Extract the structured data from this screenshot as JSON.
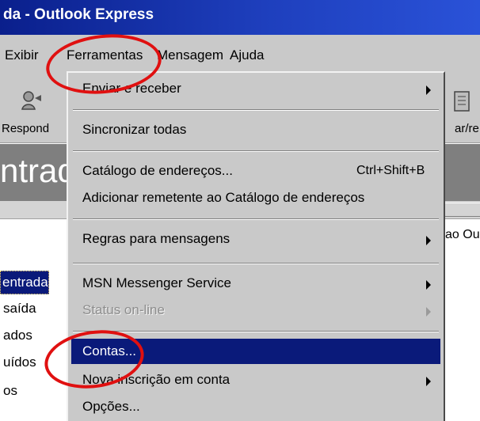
{
  "window": {
    "title": "da - Outlook Express"
  },
  "menubar": {
    "items": [
      {
        "label": "Exibir"
      },
      {
        "label": "Ferramentas"
      },
      {
        "label": "Mensagem"
      },
      {
        "label": "Ajuda"
      }
    ]
  },
  "toolbar": {
    "reply_label": "Respond",
    "forward_label": "ar/re"
  },
  "folder_header": {
    "title": "ntrad"
  },
  "side_text": "ao Ou",
  "folders": [
    {
      "label": "entrada"
    },
    {
      "label": "saída"
    },
    {
      "label": "ados"
    },
    {
      "label": "uídos"
    },
    {
      "label": "os"
    }
  ],
  "dropdown": {
    "items": {
      "send_receive": "Enviar e receber",
      "sync_all": "Sincronizar todas",
      "address_book": "Catálogo de endereços...",
      "address_book_shortcut": "Ctrl+Shift+B",
      "add_sender": "Adicionar remetente ao Catálogo de endereços",
      "rules": "Regras para mensagens",
      "msn": "MSN Messenger Service",
      "status": "Status on-line",
      "accounts": "Contas...",
      "new_account": "Nova inscrição em conta",
      "options": "Opções..."
    }
  },
  "colors": {
    "title_bar": "#0a1f8c",
    "highlight": "#0a1a7a",
    "annotation": "#e01010",
    "menu_bg": "#c9c9c9"
  }
}
